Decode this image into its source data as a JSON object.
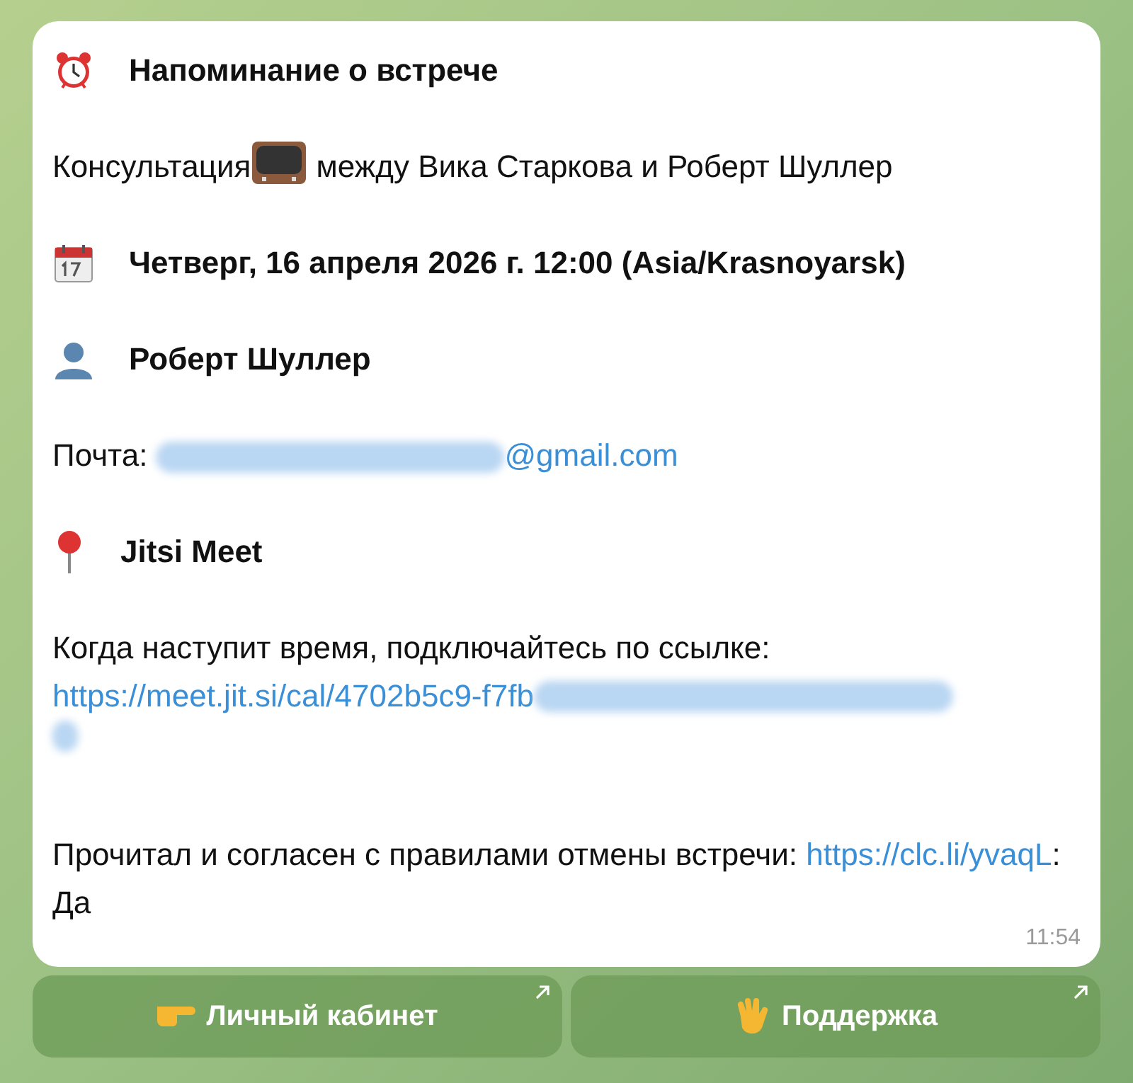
{
  "message": {
    "title": "Напоминание о встрече",
    "consultation": {
      "before": "Консультация",
      "after": "между Вика Старкова и Роберт Шуллер"
    },
    "datetime": "Четверг, 16 апреля 2026 г. 12:00 (Asia/Krasnoyarsk)",
    "person": "Роберт Шуллер",
    "email": {
      "label": "Почта:",
      "domain": "@gmail.com"
    },
    "location": "Jitsi Meet",
    "join_text": "Когда наступит время, подключайтесь по ссылке:",
    "join_link": "https://meet.jit.si/cal/4702b5c9-f7fb",
    "agreement": {
      "text": "Прочитал и согласен с правилами отмены встречи:",
      "link": "https://clc.li/yvaqL",
      "answer": ": Да"
    },
    "time": "11:54"
  },
  "buttons": [
    {
      "label": "Личный кабинет",
      "kind": "point"
    },
    {
      "label": "Поддержка",
      "kind": "wave"
    }
  ]
}
